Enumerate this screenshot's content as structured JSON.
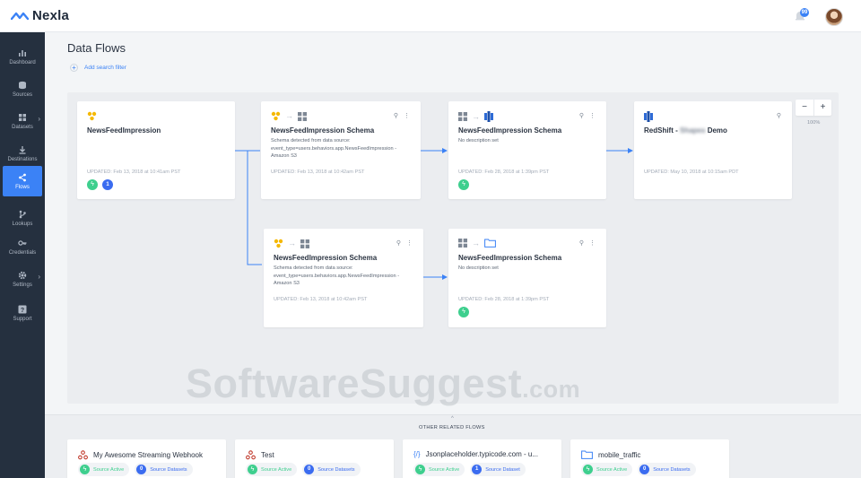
{
  "app": {
    "name": "Nexla",
    "notification_count": "99"
  },
  "sidebar": {
    "items": [
      {
        "label": "Dashboard",
        "icon": "bar-chart-icon"
      },
      {
        "label": "Sources",
        "icon": "database-icon"
      },
      {
        "label": "Datasets",
        "icon": "grid-icon"
      },
      {
        "label": "Destinations",
        "icon": "download-icon"
      },
      {
        "label": "Flows",
        "icon": "share-icon"
      },
      {
        "label": "Lookups",
        "icon": "branch-icon"
      },
      {
        "label": "Credentials",
        "icon": "key-icon"
      },
      {
        "label": "Settings",
        "icon": "gear-icon"
      },
      {
        "label": "Support",
        "icon": "help-icon"
      }
    ]
  },
  "page": {
    "title": "Data Flows",
    "add_filter": "Add search filter"
  },
  "flow": {
    "nodes": [
      {
        "title": "NewsFeedImpression",
        "desc": "",
        "updated": "UPDATED: Feb 13, 2018 at 10:41am PST",
        "badge": "1"
      },
      {
        "title": "NewsFeedImpression Schema",
        "desc": "Schema detected from data source: event_type=users.behaviors.app.NewsFeedImpression - Amazon S3",
        "updated": "UPDATED: Feb 13, 2018 at 10:42am PST"
      },
      {
        "title": "NewsFeedImpression Schema",
        "desc": "No description set",
        "updated": "UPDATED: Feb 28, 2018 at 1:39pm PST"
      },
      {
        "title_prefix": "RedShift - ",
        "title_blurred": "Shapes",
        "title_suffix": " Demo",
        "updated": "UPDATED: May 10, 2018 at 10:15am PDT"
      },
      {
        "title": "NewsFeedImpression Schema",
        "desc": "Schema detected from data source: event_type=users.behaviors.app.NewsFeedImpression - Amazon S3",
        "updated": "UPDATED: Feb 13, 2018 at 10:42am PST"
      },
      {
        "title": "NewsFeedImpression Schema",
        "desc": "No description set",
        "updated": "UPDATED: Feb 28, 2018 at 1:39pm PST"
      }
    ]
  },
  "zoom": {
    "minus": "−",
    "plus": "+",
    "level": "100%"
  },
  "watermark": {
    "main": "SoftwareSuggest",
    "suffix": ".com"
  },
  "related": {
    "caret": "^",
    "label": "OTHER RELATED FLOWS",
    "flows": [
      {
        "title": "My Awesome Streaming Webhook",
        "icon": "webhook-icon",
        "status": "Source Active",
        "count": "0",
        "count_label": "Source Datasets"
      },
      {
        "title": "Test",
        "icon": "webhook-icon",
        "status": "Source Active",
        "count": "0",
        "count_label": "Source Datasets"
      },
      {
        "title": "Jsonplaceholder.typicode.com - u...",
        "icon": "code-icon",
        "status": "Source Active",
        "count": "1",
        "count_label": "Source Dataset"
      },
      {
        "title": "mobile_traffic",
        "icon": "folder-icon",
        "status": "Source Active",
        "count": "0",
        "count_label": "Source Datasets"
      }
    ]
  },
  "colors": {
    "accent": "#3b82f6",
    "sidebar": "#25303f",
    "active_green": "#3ecf8e",
    "badge_blue": "#3b6cf0"
  }
}
